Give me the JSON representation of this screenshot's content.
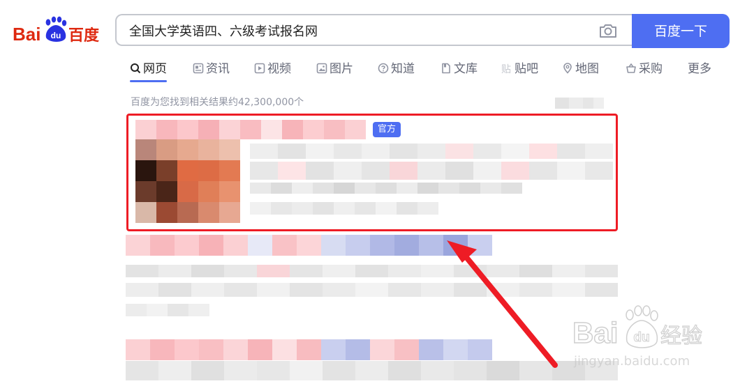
{
  "logo": {
    "text_left": "Bai",
    "text_right": "百度",
    "paw_text": "du"
  },
  "search": {
    "query": "全国大学英语四、六级考试报名网"
  },
  "search_button": {
    "label": "百度一下"
  },
  "tabs": [
    {
      "label": "网页",
      "icon": "search-icon",
      "active": true
    },
    {
      "label": "资讯",
      "icon": "news-icon"
    },
    {
      "label": "视频",
      "icon": "video-icon"
    },
    {
      "label": "图片",
      "icon": "image-icon"
    },
    {
      "label": "知道",
      "icon": "question-icon"
    },
    {
      "label": "文库",
      "icon": "document-icon"
    },
    {
      "label": "贴吧",
      "icon": "tieba-icon"
    },
    {
      "label": "地图",
      "icon": "map-pin-icon"
    },
    {
      "label": "采购",
      "icon": "basket-icon"
    },
    {
      "label": "更多",
      "icon": ""
    }
  ],
  "results": {
    "count_text": "百度为您找到相关结果约42,300,000个"
  },
  "badge": {
    "official": "官方"
  },
  "watermark": {
    "brand_left": "Bai",
    "brand_paw": "du",
    "brand_cn": "经验",
    "url": "jingyan.baidu.com"
  },
  "colors": {
    "accent": "#4e6ef2",
    "logo_red": "#de2910",
    "logo_blue": "#2932e1",
    "annotation_red": "#ee1c25"
  }
}
